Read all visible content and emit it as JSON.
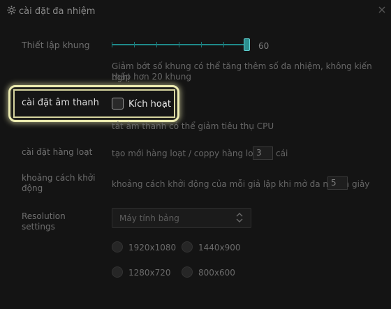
{
  "window": {
    "title": "cài đặt đa nhiệm",
    "title_icon": "gear-icon",
    "close_icon": "close-icon"
  },
  "frame": {
    "label": "Thiết lập khung",
    "slider_value": "60",
    "slider_level": 60,
    "description_line1": "Giảm bớt số khung có thể tăng thêm số đa nhiệm, không kiến nghị",
    "description_line2": "thấp hơn 20 khung"
  },
  "audio": {
    "label": "cài đặt âm thanh",
    "checkbox_label": "Kích hoạt",
    "description": "tắt âm thanh có thể giảm tiêu thụ CPU"
  },
  "batch": {
    "label": "cài đặt hàng loạt",
    "text_before": "tạo mới hàng loạt / coppy hàng loạt",
    "value": "3",
    "unit": "cái"
  },
  "startup": {
    "label_line1": "khoảng cách khởi",
    "label_line2": "động",
    "text_before": "khoảng cách khởi động của mỗi giả lập khi mở đa nhiệm",
    "value": "5",
    "unit": "giây"
  },
  "resolution": {
    "label_line1": "Resolution",
    "label_line2": "settings",
    "selected": "Máy tính bảng",
    "options": [
      "1920x1080",
      "1440x900",
      "1280x720",
      "800x600"
    ]
  },
  "colors": {
    "accent": "#2c8f8f",
    "highlight": "#ecebb0"
  }
}
